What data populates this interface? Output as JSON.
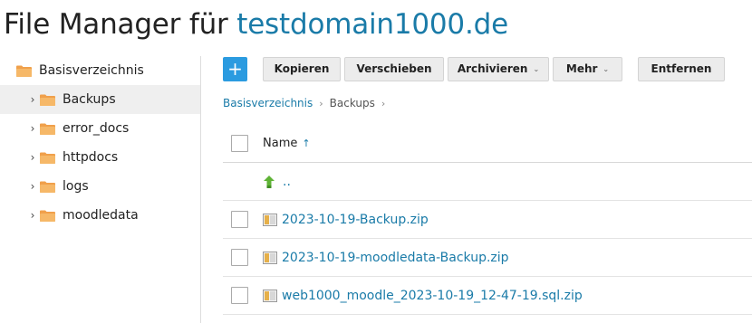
{
  "header": {
    "title_prefix": "File Manager für ",
    "domain": "testdomain1000.de"
  },
  "sidebar": {
    "root": {
      "label": "Basisverzeichnis",
      "icon": "folder-icon"
    },
    "items": [
      {
        "label": "Backups",
        "selected": true
      },
      {
        "label": "error_docs",
        "selected": false
      },
      {
        "label": "httpdocs",
        "selected": false
      },
      {
        "label": "logs",
        "selected": false
      },
      {
        "label": "moodledata",
        "selected": false
      }
    ]
  },
  "toolbar": {
    "add_label": "+",
    "copy_label": "Kopieren",
    "move_label": "Verschieben",
    "archive_label": "Archivieren",
    "more_label": "Mehr",
    "remove_label": "Entfernen"
  },
  "breadcrumb": {
    "root": "Basisverzeichnis",
    "current": "Backups"
  },
  "table": {
    "name_header": "Name",
    "sort_indicator": "↑",
    "parent_label": "..",
    "files": [
      {
        "name": "2023-10-19-Backup.zip"
      },
      {
        "name": "2023-10-19-moodledata-Backup.zip"
      },
      {
        "name": "web1000_moodle_2023-10-19_12-47-19.sql.zip"
      }
    ]
  },
  "colors": {
    "accent": "#1a7ba8",
    "add_button": "#2b9be0",
    "folder": "#f0a04b",
    "up_arrow": "#5fb336"
  }
}
